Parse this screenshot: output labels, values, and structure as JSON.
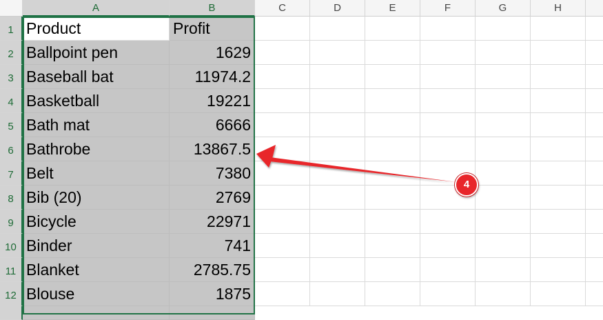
{
  "columns": [
    "A",
    "B",
    "C",
    "D",
    "E",
    "F",
    "G",
    "H"
  ],
  "rows": [
    {
      "num": "1",
      "a": "Product",
      "b": "Profit"
    },
    {
      "num": "2",
      "a": "Ballpoint pen",
      "b": "1629"
    },
    {
      "num": "3",
      "a": "Baseball bat",
      "b": "11974.2"
    },
    {
      "num": "4",
      "a": "Basketball",
      "b": "19221"
    },
    {
      "num": "5",
      "a": "Bath mat",
      "b": "6666"
    },
    {
      "num": "6",
      "a": "Bathrobe",
      "b": "13867.5"
    },
    {
      "num": "7",
      "a": "Belt",
      "b": "7380"
    },
    {
      "num": "8",
      "a": "Bib (20)",
      "b": "2769"
    },
    {
      "num": "9",
      "a": "Bicycle",
      "b": "22971"
    },
    {
      "num": "10",
      "a": "Binder",
      "b": "741"
    },
    {
      "num": "11",
      "a": "Blanket",
      "b": "2785.75"
    },
    {
      "num": "12",
      "a": "Blouse",
      "b": "1875"
    }
  ],
  "annotation": {
    "label": "4",
    "color": "#e8262b"
  },
  "colors": {
    "selection_border": "#217346",
    "selection_fill": "#c6c6c6",
    "header_text": "#1e6b36"
  }
}
